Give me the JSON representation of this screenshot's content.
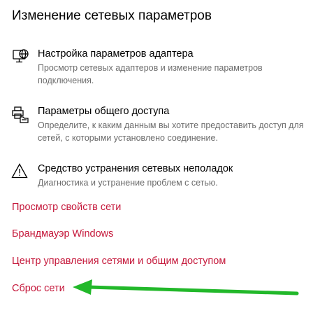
{
  "page": {
    "title": "Изменение сетевых параметров"
  },
  "settings": [
    {
      "icon": "network-adapter-icon",
      "title": "Настройка параметров адаптера",
      "description": "Просмотр сетевых адаптеров и изменение параметров подключения."
    },
    {
      "icon": "sharing-printer-icon",
      "title": "Параметры общего доступа",
      "description": "Определите, к каким данным вы хотите предоставить доступ для сетей, с которыми установлено соединение."
    },
    {
      "icon": "warning-triangle-icon",
      "title": "Средство устранения сетевых неполадок",
      "description": "Диагностика и устранение проблем с сетью."
    }
  ],
  "links": {
    "network_properties": "Просмотр свойств сети",
    "windows_firewall": "Брандмауэр Windows",
    "network_sharing_center": "Центр управления сетями и общим доступом",
    "network_reset": "Сброс сети"
  },
  "colors": {
    "link": "#c5173a",
    "description": "#6b6b6b",
    "annotation_arrow": "#22b82a"
  },
  "annotation": {
    "icon": "green-arrow-pointing-to-network-reset"
  }
}
